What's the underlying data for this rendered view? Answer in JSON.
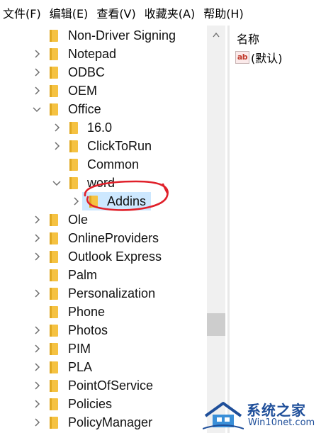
{
  "menu": {
    "file": "文件(F)",
    "edit": "编辑(E)",
    "view": "查看(V)",
    "favorites": "收藏夹(A)",
    "help": "帮助(H)"
  },
  "tree": {
    "items": [
      {
        "label": "Non-Driver Signing",
        "chevron": "none"
      },
      {
        "label": "Notepad",
        "chevron": "right"
      },
      {
        "label": "ODBC",
        "chevron": "right"
      },
      {
        "label": "OEM",
        "chevron": "right"
      },
      {
        "label": "Office",
        "chevron": "down"
      },
      {
        "label": "16.0",
        "chevron": "right"
      },
      {
        "label": "ClickToRun",
        "chevron": "right"
      },
      {
        "label": "Common",
        "chevron": "none"
      },
      {
        "label": "word",
        "chevron": "down"
      },
      {
        "label": "Addins",
        "chevron": "right",
        "selected": true
      },
      {
        "label": "Ole",
        "chevron": "right"
      },
      {
        "label": "OnlineProviders",
        "chevron": "right"
      },
      {
        "label": "Outlook Express",
        "chevron": "right"
      },
      {
        "label": "Palm",
        "chevron": "none"
      },
      {
        "label": "Personalization",
        "chevron": "right"
      },
      {
        "label": "Phone",
        "chevron": "none"
      },
      {
        "label": "Photos",
        "chevron": "right"
      },
      {
        "label": "PIM",
        "chevron": "right"
      },
      {
        "label": "PLA",
        "chevron": "right"
      },
      {
        "label": "PointOfService",
        "chevron": "right"
      },
      {
        "label": "Policies",
        "chevron": "right"
      },
      {
        "label": "PolicyManager",
        "chevron": "right"
      }
    ]
  },
  "values": {
    "column_name": "名称",
    "rows": [
      {
        "icon": "string-value-icon",
        "name": "(默认)"
      }
    ]
  },
  "watermark": {
    "title": "系统之家",
    "url": "Win10net.com"
  },
  "colors": {
    "folder": "#f5c242",
    "selection": "#cde8ff",
    "annotation": "#e0202a",
    "watermark": "#1f4f9a"
  }
}
